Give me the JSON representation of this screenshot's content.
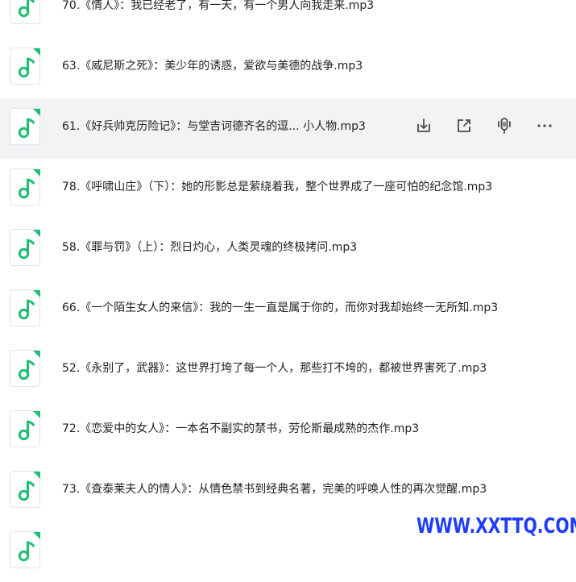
{
  "files": [
    {
      "name": "70.《情人》：我已经老了，有一天，有一个男人向我走来.mp3",
      "icon": "music-file-icon"
    },
    {
      "name": "63.《威尼斯之死》：美少年的诱惑，爱欲与美德的战争.mp3",
      "icon": "music-file-icon"
    },
    {
      "name": "61.《好兵帅克历险记》：与堂吉诃德齐名的逗... 小人物.mp3",
      "icon": "music-file-icon",
      "hovered": true
    },
    {
      "name": "78.《呼啸山庄》（下）：她的形影总是萦绕着我，整个世界成了一座可怕的纪念馆.mp3",
      "icon": "music-file-icon"
    },
    {
      "name": "58.《罪与罚》（上）：烈日灼心，人类灵魂的终极拷问.mp3",
      "icon": "music-file-icon"
    },
    {
      "name": "66.《一个陌生女人的来信》：我的一生一直是属于你的，而你对我却始终一无所知.mp3",
      "icon": "music-file-icon"
    },
    {
      "name": "52.《永别了，武器》：这世界打垮了每一个人，那些打不垮的，都被世界害死了.mp3",
      "icon": "music-file-icon"
    },
    {
      "name": "72.《恋爱中的女人》：一本名不副实的禁书，劳伦斯最成熟的杰作.mp3",
      "icon": "music-file-icon"
    },
    {
      "name": "73.《查泰莱夫人的情人》：从情色禁书到经典名著，完美的呼唤人性的再次觉醒.mp3",
      "icon": "music-file-icon"
    },
    {
      "name": "",
      "icon": "music-file-icon"
    }
  ],
  "row_actions": [
    "download-icon",
    "share-icon",
    "transcribe-icon",
    "more-icon"
  ],
  "watermark": "WWW.XXTTQ.COM",
  "colors": {
    "accent": "#1ebf73",
    "hover_bg": "#f2f3f5",
    "text": "#1f1f1f",
    "icon_gray": "#4a4a4a",
    "watermark": "#1f3cff"
  }
}
